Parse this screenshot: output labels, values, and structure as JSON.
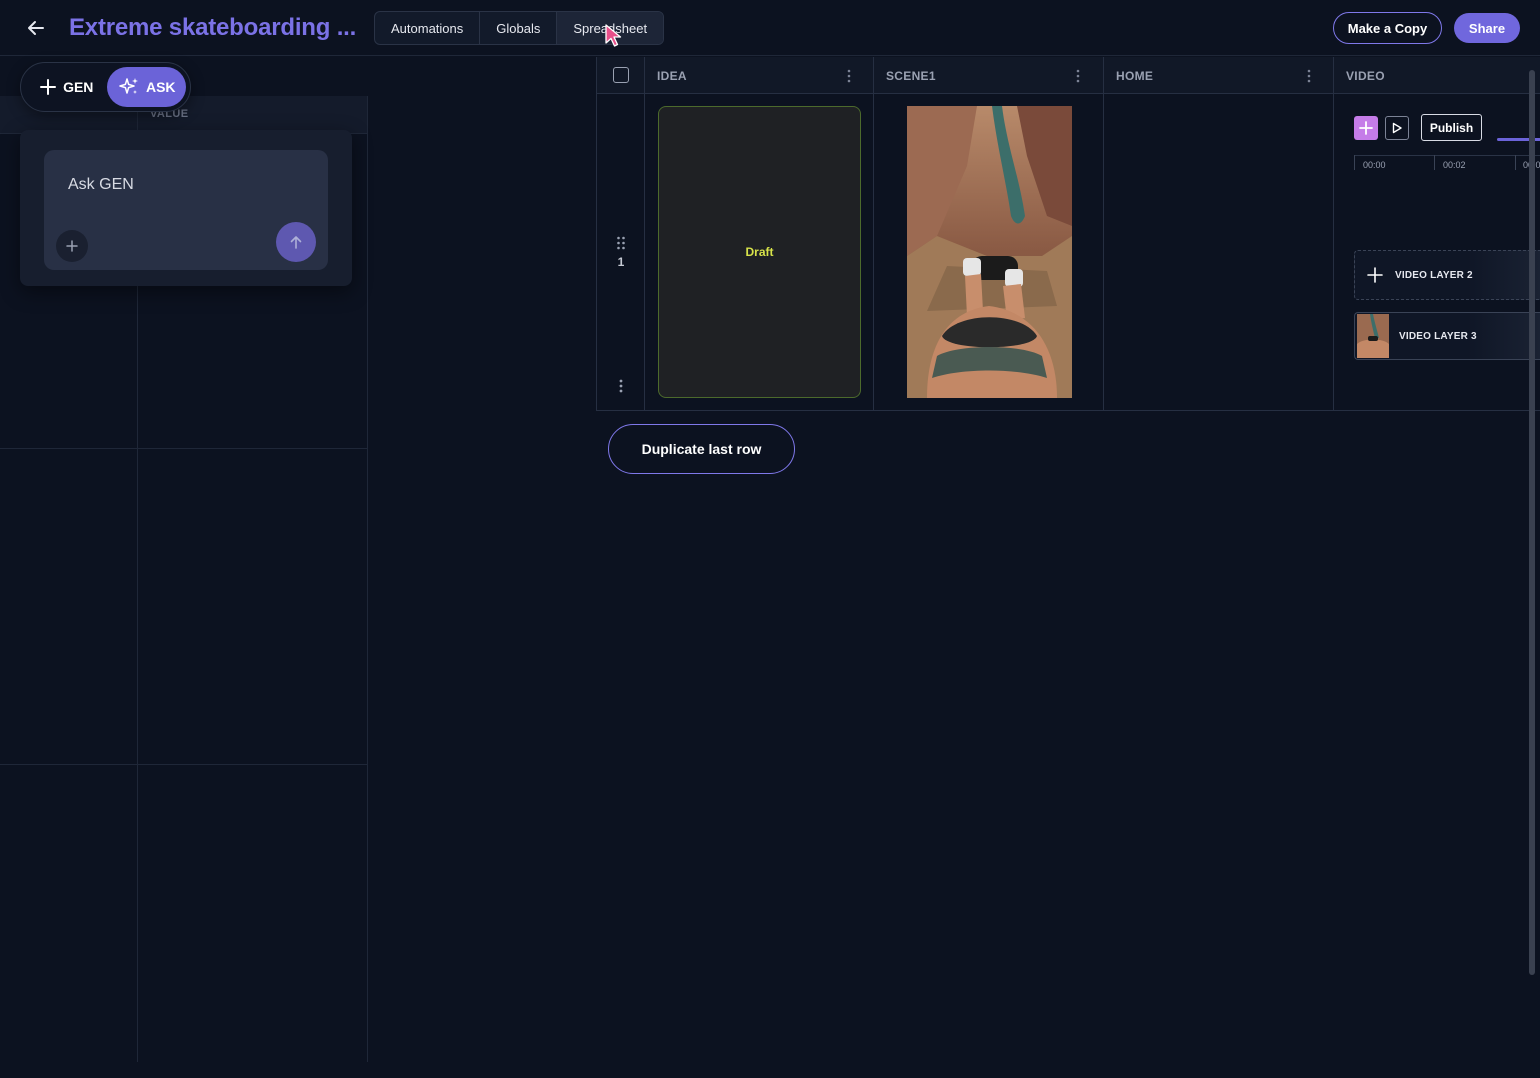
{
  "header": {
    "title": "Extreme skateboarding ...",
    "tabs": [
      {
        "label": "Automations"
      },
      {
        "label": "Globals"
      },
      {
        "label": "Spreadsheet"
      }
    ],
    "active_tab": "Spreadsheet",
    "make_copy_label": "Make a Copy",
    "share_label": "Share"
  },
  "left_panel": {
    "column_label": "VALUE",
    "mode_gen_label": "GEN",
    "mode_ask_label": "ASK",
    "ask_placeholder": "Ask GEN"
  },
  "sheet": {
    "columns": [
      {
        "label": "IDEA"
      },
      {
        "label": "SCENE1"
      },
      {
        "label": "HOME"
      },
      {
        "label": "VIDEO"
      }
    ],
    "rows": [
      {
        "number": "1",
        "idea_status": "Draft"
      }
    ],
    "duplicate_label": "Duplicate last row"
  },
  "video_editor": {
    "publish_label": "Publish",
    "timestamps": [
      "00:00",
      "00:02",
      "00:0"
    ],
    "layers": [
      {
        "name": "VIDEO LAYER 2"
      },
      {
        "name": "VIDEO LAYER 3"
      }
    ]
  },
  "colors": {
    "accent": "#6b63d8",
    "title": "#7b72e6",
    "background": "#0c1220",
    "draft": "#d7e34a",
    "add_layer": "#c57ce8"
  }
}
